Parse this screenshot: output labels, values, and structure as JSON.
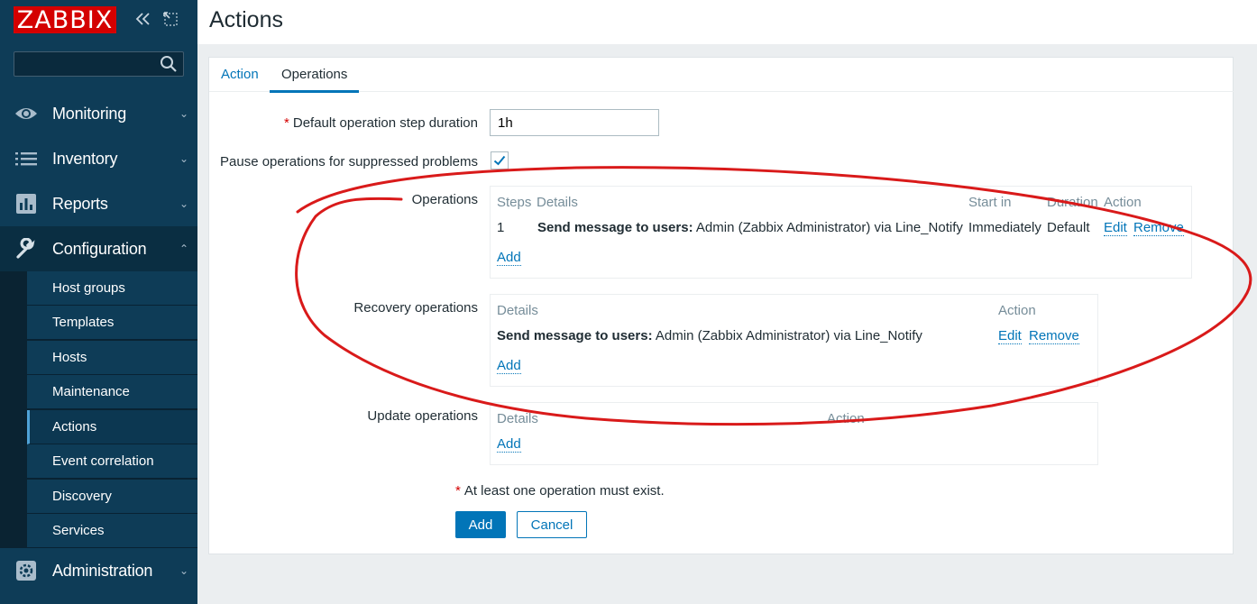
{
  "sidebar": {
    "logo": "ZABBIX",
    "search": {
      "placeholder": "",
      "value": ""
    },
    "menu": [
      {
        "label": "Monitoring",
        "icon": "eye-icon",
        "chevron": "⌄"
      },
      {
        "label": "Inventory",
        "icon": "list-icon",
        "chevron": "⌄"
      },
      {
        "label": "Reports",
        "icon": "bar-chart-icon",
        "chevron": "⌄"
      },
      {
        "label": "Configuration",
        "icon": "wrench-icon",
        "chevron": "⌃"
      },
      {
        "label": "Administration",
        "icon": "gear-icon",
        "chevron": "⌄"
      }
    ],
    "submenu": [
      "Host groups",
      "Templates",
      "Hosts",
      "Maintenance",
      "Actions",
      "Event correlation",
      "Discovery",
      "Services"
    ]
  },
  "header": {
    "title": "Actions"
  },
  "tabs": [
    {
      "label": "Action",
      "active": false
    },
    {
      "label": "Operations",
      "active": true
    }
  ],
  "form": {
    "step_duration": {
      "label": "Default operation step duration",
      "required": "*",
      "value": "1h"
    },
    "pause": {
      "label": "Pause operations for suppressed problems",
      "checked": true
    },
    "operations": {
      "label": "Operations",
      "headers": [
        "Steps",
        "Details",
        "Start in",
        "Duration",
        "Action"
      ],
      "rows": [
        {
          "step": "1",
          "details_bold": "Send message to users:",
          "details": " Admin (Zabbix Administrator) via Line_Notify",
          "start_in": "Immediately",
          "duration": "Default",
          "edit": "Edit",
          "remove": "Remove"
        }
      ],
      "add": "Add"
    },
    "recovery": {
      "label": "Recovery operations",
      "headers": [
        "Details",
        "Action"
      ],
      "rows": [
        {
          "details_bold": "Send message to users:",
          "details": " Admin (Zabbix Administrator) via Line_Notify",
          "edit": "Edit",
          "remove": "Remove"
        }
      ],
      "add": "Add"
    },
    "update": {
      "label": "Update operations",
      "headers": [
        "Details",
        "Action"
      ],
      "add": "Add"
    },
    "note": {
      "required": "*",
      "text": "At least one operation must exist."
    },
    "buttons": {
      "add": "Add",
      "cancel": "Cancel"
    }
  },
  "colors": {
    "sidebar": "#0e3c57",
    "accent": "#0275b8",
    "logo": "#d40000",
    "annotation": "#d91a1a"
  }
}
